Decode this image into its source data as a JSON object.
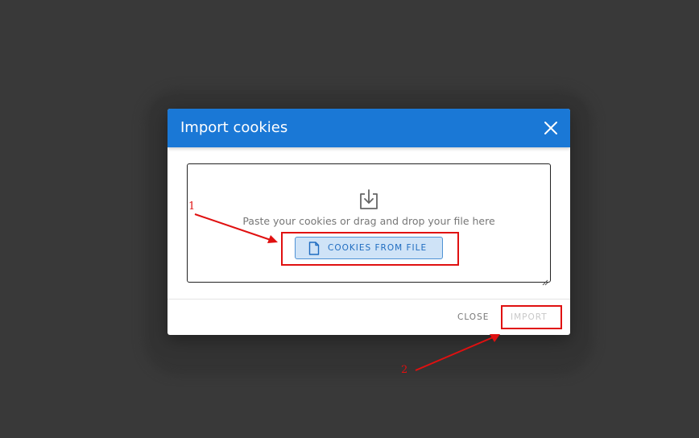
{
  "dialog": {
    "title": "Import cookies",
    "dropzone_text": "Paste your cookies or drag and drop your file here",
    "file_button_label": "COOKIES FROM FILE",
    "close_button_label": "CLOSE",
    "import_button_label": "IMPORT"
  },
  "annotations": {
    "label_1": "1",
    "label_2": "2"
  },
  "icons": {
    "close": "close-icon",
    "import": "download-tray-icon",
    "file": "file-icon"
  },
  "colors": {
    "header": "#1a78d6",
    "file_button_bg": "#cfe3f7",
    "file_button_text": "#1f6cc0",
    "annotation": "#e01010",
    "backdrop": "#393939"
  }
}
